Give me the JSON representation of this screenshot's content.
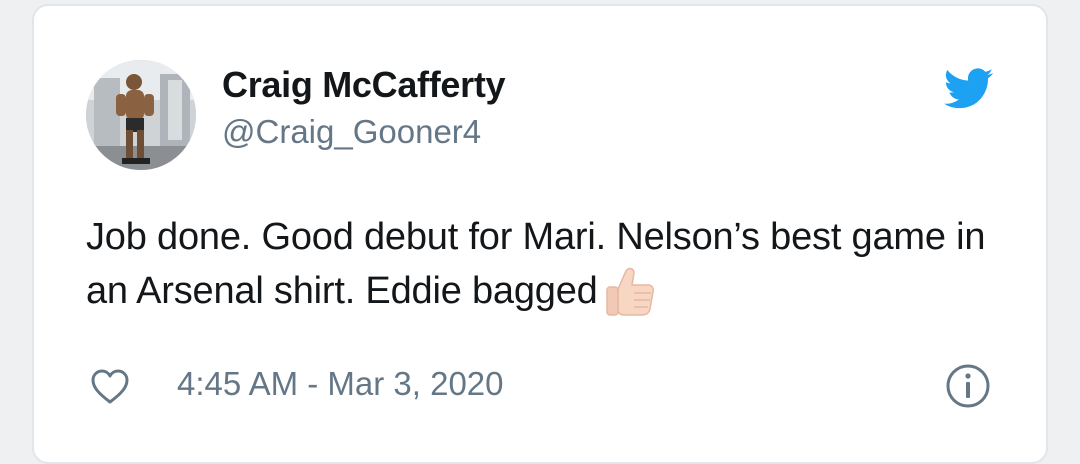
{
  "tweet": {
    "display_name": "Craig McCafferty",
    "handle": "@Craig_Gooner4",
    "text": "Job done. Good debut for Mari. Nelson’s best game in an Arsenal shirt. Eddie bagged",
    "emoji": "thumbs-up-light-skin-tone",
    "timestamp": "4:45 AM - Mar 3, 2020"
  },
  "icons": {
    "brand": "twitter-bird-icon",
    "like": "heart-icon",
    "info": "info-icon"
  },
  "colors": {
    "twitter_blue": "#1da1f2",
    "text_primary": "#14171a",
    "text_secondary": "#657786",
    "border": "#e1e6ea"
  }
}
